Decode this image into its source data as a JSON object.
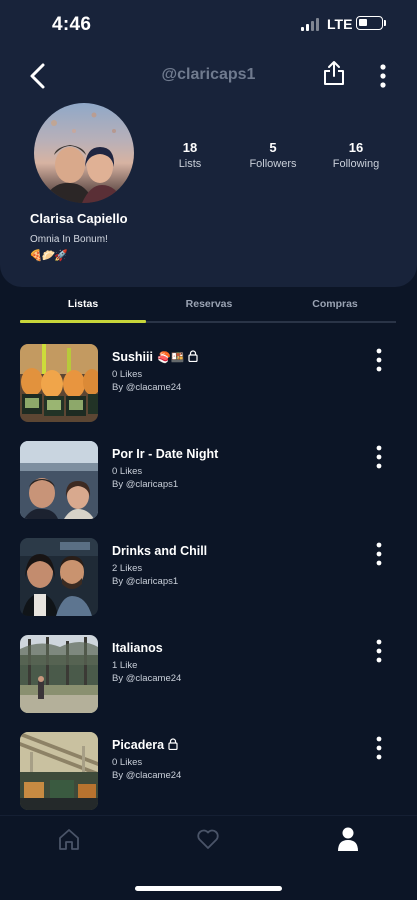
{
  "status_bar": {
    "time": "4:46",
    "network": "LTE",
    "battery_level": 0.4
  },
  "header": {
    "username": "@claricaps1",
    "back_icon": "chevron-left-icon",
    "share_icon": "share-icon",
    "more_icon": "more-vertical-icon"
  },
  "profile": {
    "stats": [
      {
        "value": "18",
        "label": "Lists"
      },
      {
        "value": "5",
        "label": "Followers"
      },
      {
        "value": "16",
        "label": "Following"
      }
    ],
    "name": "Clarisa Capiello",
    "bio": "Omnia In Bonum!",
    "emojis": "🍕🥟🚀"
  },
  "tabs": [
    {
      "label": "Listas",
      "active": true
    },
    {
      "label": "Reservas",
      "active": false
    },
    {
      "label": "Compras",
      "active": false
    }
  ],
  "lists": [
    {
      "title": "Sushiii",
      "badge": "🍣🍱",
      "locked": true,
      "likes": "0  Likes",
      "by": "By @clacame24"
    },
    {
      "title": "Por Ir - Date Night",
      "badge": "",
      "locked": false,
      "likes": "0  Likes",
      "by": "By @claricaps1"
    },
    {
      "title": "Drinks and Chill",
      "badge": "",
      "locked": false,
      "likes": "2  Likes",
      "by": "By @claricaps1"
    },
    {
      "title": "Italianos",
      "badge": "",
      "locked": false,
      "likes": "1  Like",
      "by": "By @clacame24"
    },
    {
      "title": "Picadera",
      "badge": "",
      "locked": true,
      "likes": "0  Likes",
      "by": "By @clacame24"
    }
  ],
  "colors": {
    "background": "#0c1526",
    "card": "#18233a",
    "accent": "#c8d63a"
  },
  "bottom_nav": {
    "items": [
      "home-icon",
      "heart-icon",
      "profile-icon"
    ],
    "active": "profile-icon"
  }
}
